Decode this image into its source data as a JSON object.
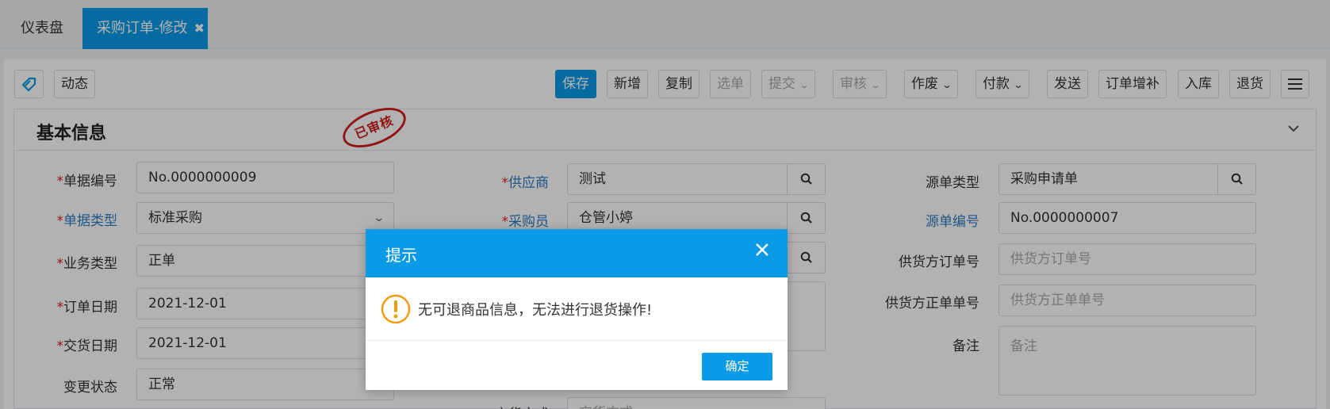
{
  "tabs": {
    "dashboard": "仪表盘",
    "active": "采购订单-修改",
    "close": "✖"
  },
  "toolbar": {
    "dynamic": "动态",
    "save": "保存",
    "add": "新增",
    "copy": "复制",
    "select": "选单",
    "submit": "提交",
    "audit": "审核",
    "void": "作废",
    "pay": "付款",
    "send": "发送",
    "supplement": "订单增补",
    "stock_in": "入库",
    "return": "退货"
  },
  "section": {
    "title": "基本信息",
    "stamp": "已审核"
  },
  "form": {
    "doc_no": {
      "label": "单据编号",
      "value": "No.0000000009"
    },
    "doc_type": {
      "label": "单据类型",
      "value": "标准采购"
    },
    "biz_type": {
      "label": "业务类型",
      "value": "正单"
    },
    "order_date": {
      "label": "订单日期",
      "value": "2021-12-01"
    },
    "delivery_date": {
      "label": "交货日期",
      "value": "2021-12-01"
    },
    "change_status": {
      "label": "变更状态",
      "value": "正常"
    },
    "supplier": {
      "label": "供应商",
      "value": "测试"
    },
    "buyer": {
      "label": "采购员",
      "value": "仓管小婷"
    },
    "delivery_method": {
      "label": "交货方式",
      "placeholder": "交货方式"
    },
    "source_type": {
      "label": "源单类型",
      "value": "采购申请单"
    },
    "source_no": {
      "label": "源单编号",
      "value": "No.0000000007"
    },
    "supplier_order_no": {
      "label": "供货方订单号",
      "placeholder": "供货方订单号"
    },
    "supplier_doc_no": {
      "label": "供货方正单单号",
      "placeholder": "供货方正单单号"
    },
    "remark": {
      "label": "备注",
      "placeholder": "备注"
    },
    "required_mark": "*"
  },
  "modal": {
    "title": "提示",
    "message": "无可退商品信息，无法进行退货操作!",
    "confirm": "确定"
  },
  "colors": {
    "primary": "#0a9ae6",
    "warning": "#f39c12",
    "required": "#e02020",
    "link": "#2f7cc2",
    "stamp": "#d21f1f"
  }
}
